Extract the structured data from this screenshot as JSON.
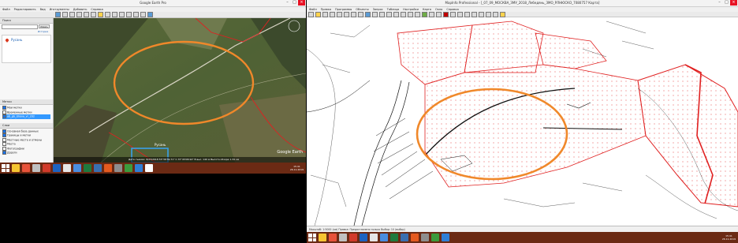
{
  "left_window": {
    "title": "Google Earth Pro",
    "menu": [
      "Файл",
      "Редактировать",
      "Вид",
      "Инструменты",
      "Добавить",
      "Справка"
    ],
    "sidebar": {
      "search_header": "Поиск",
      "search_placeholder": "",
      "search_button": "Искать",
      "history_link": "История",
      "result_label": "Русань",
      "places_header": "Метки",
      "places": [
        "Мои метки",
        "Временные метки",
        "ab_gb_izkova_vr_202"
      ],
      "layers_header": "Слои",
      "layers": [
        "Основная база данных",
        "Границы и метки",
        "Местные места и отмены",
        "Места",
        "Фотографии",
        "Дороги"
      ]
    },
    "map": {
      "label": "Русань",
      "status": "Дата съемки: 8/23/2018   55°38'39.71\" С  37°45'08.94\" В  выс. 140 м  Высота обзора 1.34 км",
      "brand": "Google Earth"
    }
  },
  "right_window": {
    "title": "MapInfo Professional - [_07_09_МОСКВА_ЗМУ_2018_Лебедянь_ЗМО_РЛНЮСКО_7080757 Карта]",
    "menu": [
      "Файл",
      "Правка",
      "Программы",
      "Объекты",
      "Запрос",
      "Таблица",
      "Настройки",
      "Карта",
      "Окно",
      "Справка"
    ],
    "statusbar": "Масштаб: 1:5000 (км)          Правка: Предоставлено только Выбор: 10 (выбор)"
  },
  "taskbar": {
    "time": "15:41",
    "date": "26.11.2019"
  },
  "colors": {
    "ellipse": "#f0882a",
    "parcel": "#e02020",
    "taskbar": "#6b2a14",
    "highlight": "#3aa0e8"
  }
}
